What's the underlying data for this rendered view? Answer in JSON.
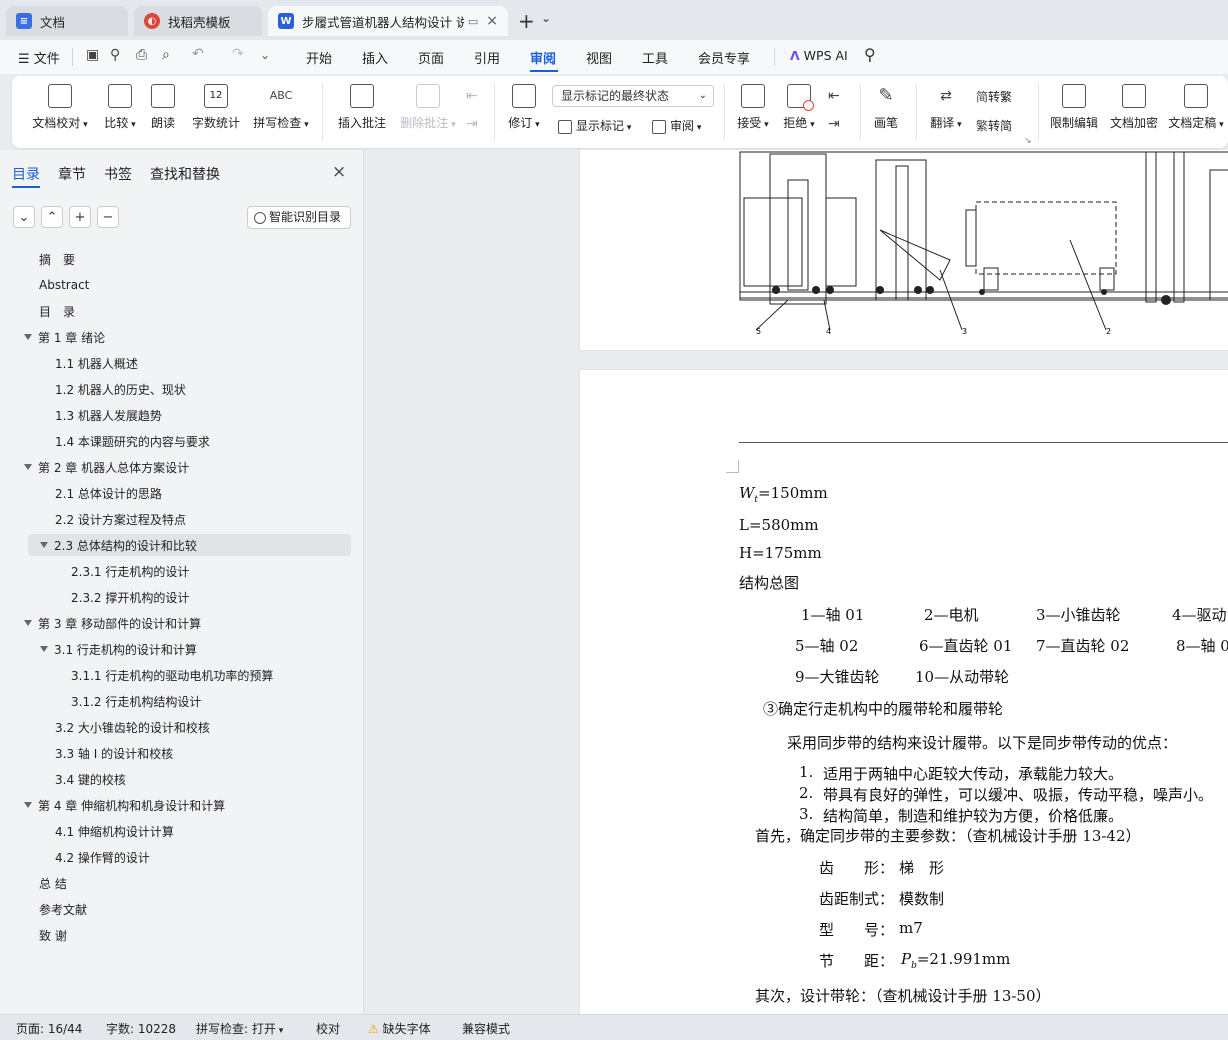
{
  "tabs": [
    {
      "label": "文档"
    },
    {
      "label": "找稻壳模板"
    },
    {
      "label": "步履式管道机器人结构设计 说"
    }
  ],
  "tab_actions": {
    "new": "+",
    "more": "⌄"
  },
  "menu": {
    "file": "文件",
    "items": [
      "开始",
      "插入",
      "页面",
      "引用",
      "审阅",
      "视图",
      "工具",
      "会员专享"
    ],
    "active": "审阅",
    "ai": "WPS AI"
  },
  "ribbon": {
    "doc_check": "文档校对",
    "compare": "比较",
    "read_aloud": "朗读",
    "word_count": "字数统计",
    "spell_check": "拼写检查",
    "spell_icon": "ABC",
    "count_icon": "12",
    "insert_comment": "插入批注",
    "delete_comment": "删除批注",
    "revise": "修订",
    "markup_state": "显示标记的最终状态",
    "show_markup": "显示标记",
    "review": "审阅",
    "accept": "接受",
    "reject": "拒绝",
    "pen": "画笔",
    "translate": "翻译",
    "to_traditional": "转繁",
    "to_simplified": "转简",
    "restrict_edit": "限制编辑",
    "encrypt": "文档加密",
    "finalize": "文档定稿"
  },
  "nav": {
    "tabs": [
      "目录",
      "章节",
      "书签",
      "查找和替换"
    ],
    "active_tab": "目录",
    "smart_toc": "智能识别目录",
    "controls": [
      "⌄",
      "⌃",
      "+",
      "−"
    ],
    "toc": [
      {
        "label": "摘　要",
        "level": 1,
        "caret": false
      },
      {
        "label": "Abstract",
        "level": 1,
        "caret": false
      },
      {
        "label": "目　录",
        "level": 1,
        "caret": false
      },
      {
        "label": "第 1 章  绪论",
        "level": 1,
        "caret": true
      },
      {
        "label": "1.1  机器人概述",
        "level": 2,
        "caret": false
      },
      {
        "label": "1.2  机器人的历史、现状",
        "level": 2,
        "caret": false
      },
      {
        "label": "1.3 机器人发展趋势",
        "level": 2,
        "caret": false
      },
      {
        "label": "1.4  本课题研究的内容与要求",
        "level": 2,
        "caret": false
      },
      {
        "label": "第 2 章  机器人总体方案设计",
        "level": 1,
        "caret": true
      },
      {
        "label": "2.1 总体设计的思路",
        "level": 2,
        "caret": false
      },
      {
        "label": "2.2  设计方案过程及特点",
        "level": 2,
        "caret": false
      },
      {
        "label": "2.3  总体结构的设计和比较",
        "level": 2,
        "caret": true,
        "selected": true
      },
      {
        "label": "2.3.1  行走机构的设计",
        "level": 3,
        "caret": false
      },
      {
        "label": "2.3.2  撑开机构的设计",
        "level": 3,
        "caret": false
      },
      {
        "label": "第 3 章  移动部件的设计和计算",
        "level": 1,
        "caret": true
      },
      {
        "label": "3.1  行走机构的设计和计算",
        "level": 2,
        "caret": true
      },
      {
        "label": "3.1.1  行走机构的驱动电机功率的预算",
        "level": 3,
        "caret": false
      },
      {
        "label": "3.1.2  行走机构结构设计",
        "level": 3,
        "caret": false
      },
      {
        "label": "3.2 大小锥齿轮的设计和校核",
        "level": 2,
        "caret": false
      },
      {
        "label": "3.3  轴 I 的设计和校核",
        "level": 2,
        "caret": false
      },
      {
        "label": "3.4  键的校核",
        "level": 2,
        "caret": false
      },
      {
        "label": "第 4 章  伸缩机构和机身设计和计算",
        "level": 1,
        "caret": true
      },
      {
        "label": "4.1  伸缩机构设计计算",
        "level": 2,
        "caret": false
      },
      {
        "label": "4.2 操作臂的设计",
        "level": 2,
        "caret": false
      },
      {
        "label": "总 结",
        "level": 1,
        "caret": false
      },
      {
        "label": "参考文献",
        "level": 1,
        "caret": false
      },
      {
        "label": "致 谢",
        "level": 1,
        "caret": false
      }
    ]
  },
  "drawing": {
    "labels": [
      "5",
      "4",
      "3",
      "2"
    ]
  },
  "doc": {
    "w_var": "W",
    "w_sub": "t",
    "w_val": "=150mm",
    "L": "L=580mm",
    "H": "H=175mm",
    "structure_title": "结构总图",
    "legend_rows": [
      [
        "1—轴 01",
        "2—电机",
        "3—小锥齿轮",
        "4—驱动"
      ],
      [
        "5—轴 02",
        "6—直齿轮 01",
        "7—直齿轮 02",
        "8—轴 0"
      ],
      [
        "9—大锥齿轮",
        "10—从动带轮"
      ]
    ],
    "section3": "③确定行走机构中的履带轮和履带轮",
    "intro": "采用同步带的结构来设计履带。以下是同步带传动的优点：",
    "advantages": [
      {
        "num": "1.",
        "text": "适用于两轴中心距较大传动，承载能力较大。"
      },
      {
        "num": "2.",
        "text": "带具有良好的弹性，可以缓冲、吸振，传动平稳，噪声小。"
      },
      {
        "num": "3.",
        "text": "结构简单，制造和维护较为方便，价格低廉。"
      }
    ],
    "first": "首先，确定同步带的主要参数：（查机械设计手册 13-42）",
    "params": [
      {
        "label": "齿　　形：",
        "value": "梯　形"
      },
      {
        "label": "齿距制式：",
        "value": "模数制"
      },
      {
        "label": "型　　号：",
        "value": "m7"
      }
    ],
    "pitch_label": "节　　距：",
    "pitch_var": "P",
    "pitch_sub": "b",
    "pitch_val": "=21.991mm",
    "second": "其次，设计带轮：（查机械设计手册 13-50）"
  },
  "status": {
    "page": "页面: 16/44",
    "words": "字数: 10228",
    "spell": "拼写检查: 打开",
    "proof": "校对",
    "missing_font": "缺失字体",
    "compat": "兼容模式"
  },
  "colors": {
    "accent": "#1a5fd6",
    "wps_red": "#e0453a",
    "word_blue": "#2b5fd9",
    "doc_blue": "#3b6fe0"
  }
}
